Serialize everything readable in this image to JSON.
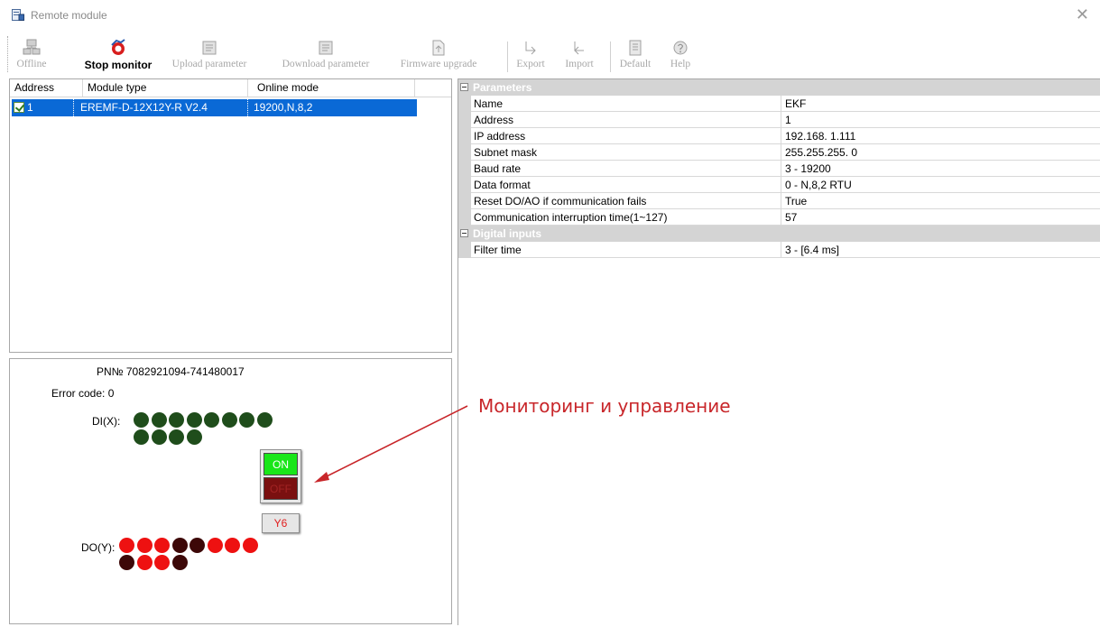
{
  "window": {
    "title": "Remote module",
    "close_glyph": "✕"
  },
  "toolbar": {
    "buttons": [
      {
        "id": "offline",
        "label": "Offline",
        "icon": "network-icon",
        "active": false
      },
      {
        "id": "stop-monitor",
        "label": "Stop monitor",
        "icon": "monitor-icon",
        "active": true
      },
      {
        "id": "upload-parameter",
        "label": "Upload parameter",
        "icon": "upload-icon",
        "active": false
      },
      {
        "id": "download-parameter",
        "label": "Download parameter",
        "icon": "download-icon",
        "active": false
      },
      {
        "id": "firmware-upgrade",
        "label": "Firmware upgrade",
        "icon": "firmware-icon",
        "active": false
      },
      {
        "id": "export",
        "label": "Export",
        "icon": "export-icon",
        "active": false
      },
      {
        "id": "import",
        "label": "Import",
        "icon": "import-icon",
        "active": false
      },
      {
        "id": "default",
        "label": "Default",
        "icon": "default-icon",
        "active": false
      },
      {
        "id": "help",
        "label": "Help",
        "icon": "help-icon",
        "active": false
      }
    ]
  },
  "module_list": {
    "columns": [
      "Address",
      "Module type",
      "Online mode"
    ],
    "rows": [
      {
        "checked": true,
        "address": "1",
        "module_type": "EREMF-D-12X12Y-R V2.4",
        "online_mode": "19200,N,8,2"
      }
    ]
  },
  "monitor": {
    "pn_text": "PN№ 7082921094-741480017",
    "error_code_text": "Error code:  0",
    "di_label": "DI(X):",
    "do_label": "DO(Y):",
    "di_states": [
      "off",
      "off",
      "off",
      "off",
      "off",
      "off",
      "off",
      "off",
      "off",
      "off",
      "off",
      "off"
    ],
    "do_states": [
      "on",
      "on",
      "on",
      "dark",
      "dark",
      "on",
      "on",
      "on",
      "dark",
      "on",
      "on",
      "dark"
    ],
    "popup": {
      "on_label": "ON",
      "off_label": "OFF",
      "channel_label": "Y6"
    }
  },
  "parameters": {
    "groups": [
      {
        "name": "Parameters",
        "rows": [
          {
            "name": "Name",
            "value": "EKF"
          },
          {
            "name": "Address",
            "value": "1"
          },
          {
            "name": "IP address",
            "value": "192.168.  1.111"
          },
          {
            "name": "Subnet mask",
            "value": "255.255.255.  0"
          },
          {
            "name": "Baud rate",
            "value": "3 - 19200"
          },
          {
            "name": "Data format",
            "value": "0 - N,8,2 RTU"
          },
          {
            "name": "Reset DO/AO if communication fails",
            "value": "True"
          },
          {
            "name": "Communication interruption time(1~127)",
            "value": "57"
          }
        ]
      },
      {
        "name": "Digital inputs",
        "rows": [
          {
            "name": "Filter time",
            "value": "3 - [6.4 ms]"
          }
        ]
      }
    ]
  },
  "annotation": {
    "text": "Мониторинг и управление",
    "color": "#c8262a"
  },
  "colors": {
    "selection": "#0a69d6",
    "led_green_off": "#1f4d1b",
    "led_red_on": "#ee1111",
    "led_red_dark": "#3d0808",
    "on_button": "#19e619",
    "off_button": "#7a1010",
    "group_header": "#d4d4d4"
  }
}
